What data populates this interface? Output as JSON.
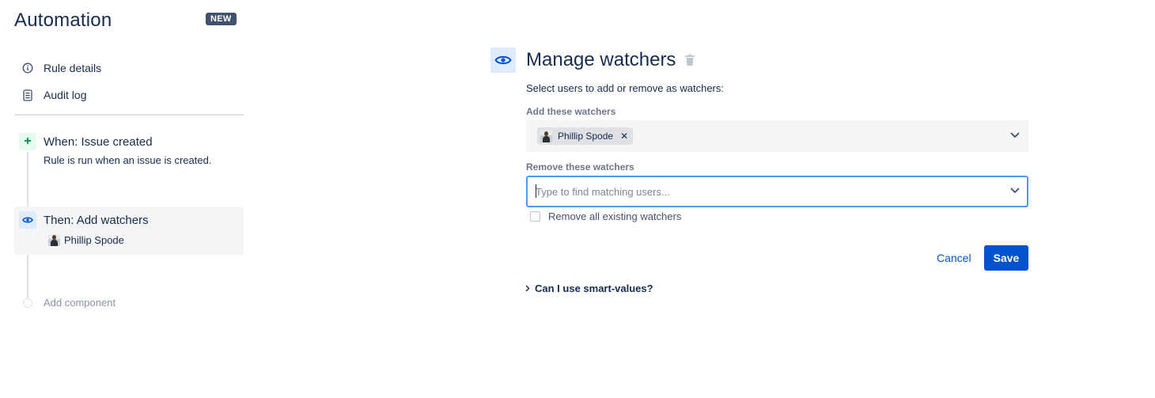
{
  "app": {
    "title": "Automation",
    "badge": "NEW"
  },
  "nav": {
    "rule_details": {
      "label": "Rule details",
      "icon": "info-icon"
    },
    "audit_log": {
      "label": "Audit log",
      "icon": "document-icon"
    }
  },
  "rule": {
    "trigger": {
      "title": "When: Issue created",
      "description": "Rule is run when an issue is created.",
      "icon": "plus-icon"
    },
    "action": {
      "title": "Then: Add watchers",
      "user": "Phillip Spode",
      "icon": "eye-icon"
    },
    "add_component": "Add component"
  },
  "panel": {
    "title": "Manage watchers",
    "helper": "Select users to add or remove as watchers:",
    "add_label": "Add these watchers",
    "add_selected": [
      "Phillip Spode"
    ],
    "remove_label": "Remove these watchers",
    "remove_placeholder": "Type to find matching users...",
    "remove_all_label": "Remove all existing watchers",
    "remove_all_checked": false,
    "cancel": "Cancel",
    "save": "Save",
    "smart_values": "Can I use smart-values?"
  },
  "colors": {
    "primary": "#0052cc",
    "text": "#172b4d",
    "trigger_bg": "#e3fcef",
    "trigger_fg": "#00875a",
    "action_bg": "#deebff",
    "focus_border": "#4c9aff"
  }
}
